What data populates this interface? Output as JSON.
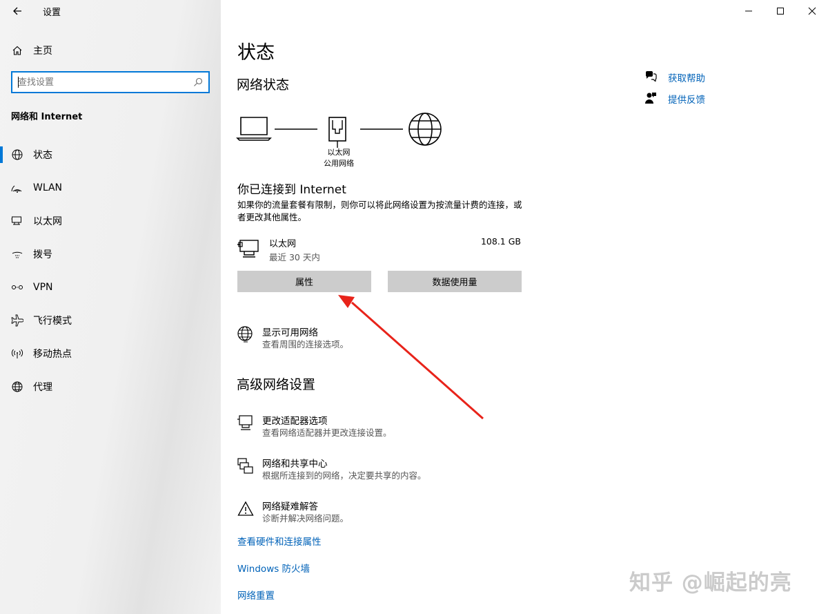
{
  "window": {
    "app_title": "设置",
    "minimize_icon": "minimize-icon",
    "maximize_icon": "maximize-icon",
    "close_icon": "close-icon"
  },
  "sidebar": {
    "home_label": "主页",
    "search": {
      "placeholder": "查找设置",
      "value": ""
    },
    "section_title": "网络和 Internet",
    "items": [
      {
        "label": "状态",
        "icon": "home-network-icon",
        "active": true
      },
      {
        "label": "WLAN",
        "icon": "wifi-icon",
        "active": false
      },
      {
        "label": "以太网",
        "icon": "ethernet-icon",
        "active": false
      },
      {
        "label": "拨号",
        "icon": "dialup-icon",
        "active": false
      },
      {
        "label": "VPN",
        "icon": "vpn-icon",
        "active": false
      },
      {
        "label": "飞行模式",
        "icon": "airplane-icon",
        "active": false
      },
      {
        "label": "移动热点",
        "icon": "hotspot-icon",
        "active": false
      },
      {
        "label": "代理",
        "icon": "globe-icon",
        "active": false
      }
    ]
  },
  "main": {
    "page_title": "状态",
    "network_status_heading": "网络状态",
    "diagram": {
      "device_label_1": "以太网",
      "device_label_2": "公用网络"
    },
    "connected_title": "你已连接到 Internet",
    "connected_desc": "如果你的流量套餐有限制，则你可以将此网络设置为按流量计费的连接，或者更改其他属性。",
    "adapter": {
      "name": "以太网",
      "period": "最近 30 天内",
      "usage": "108.1 GB"
    },
    "buttons": {
      "properties": "属性",
      "data_usage": "数据使用量"
    },
    "show_networks": {
      "title": "显示可用网络",
      "desc": "查看周围的连接选项。"
    },
    "advanced_heading": "高级网络设置",
    "advanced": [
      {
        "title": "更改适配器选项",
        "desc": "查看网络适配器并更改连接设置。"
      },
      {
        "title": "网络和共享中心",
        "desc": "根据所连接到的网络，决定要共享的内容。"
      },
      {
        "title": "网络疑难解答",
        "desc": "诊断并解决网络问题。"
      }
    ],
    "links": [
      "查看硬件和连接属性",
      "Windows 防火墙",
      "网络重置"
    ]
  },
  "related": {
    "help": "获取帮助",
    "feedback": "提供反馈"
  },
  "watermark": "知乎 @崛起的亮",
  "colors": {
    "accent": "#0078d7",
    "link": "#0062b8",
    "annotation_arrow": "#e8231a"
  }
}
